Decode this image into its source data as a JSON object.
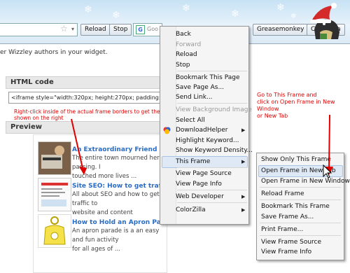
{
  "toolbar": {
    "reload_label": "Reload",
    "stop_label": "Stop",
    "search_placeholder": "Goo",
    "greasemonkey_label": "Greasemonkey",
    "colorzilla_label": "ColorZilla"
  },
  "page": {
    "top_text": "er Wizzley authors in your widget.",
    "html_code_heading": "HTML code",
    "code_value": "<iframe style=\"width:320px; height:270px; padding:2px; l",
    "preview_heading": "Preview",
    "instruction_left": "Right-click inside of the actual frame borders to get the menu shown on the right",
    "instruction_right_line1": "Go to This Frame and",
    "instruction_right_line2": "click on Open Frame in New Window",
    "instruction_right_line3": "or New Tab",
    "posts": [
      {
        "title": "An Extraordinary Friend",
        "desc1": "The entire town mourned her passing. I",
        "desc2": "touched more lives ..."
      },
      {
        "title": "Site SEO: How to get traffic",
        "desc1": "All about SEO and how to get traffic to",
        "desc2": "website and content"
      },
      {
        "title": "How to Hold an Apron Parade",
        "desc1": "An apron parade is a an easy and fun activity",
        "desc2": "for all ages of ..."
      }
    ]
  },
  "context_menu": {
    "back": "Back",
    "forward": "Forward",
    "reload": "Reload",
    "stop": "Stop",
    "bookmark": "Bookmark This Page",
    "save_page": "Save Page As...",
    "send_link": "Send Link...",
    "view_bg": "View Background Image",
    "select_all": "Select All",
    "downloadhelper": "DownloadHelper",
    "highlight": "Highlight Keyword...",
    "keyword_density": "Show Keyword Density...",
    "this_frame": "This Frame",
    "view_source": "View Page Source",
    "view_info": "View Page Info",
    "web_developer": "Web Developer",
    "colorzilla": "ColorZilla"
  },
  "frame_submenu": {
    "show_only": "Show Only This Frame",
    "new_tab": "Open Frame in New Tab",
    "new_window": "Open Frame in New Window",
    "reload_frame": "Reload Frame",
    "bookmark_frame": "Bookmark This Frame",
    "save_frame": "Save Frame As...",
    "print_frame": "Print Frame...",
    "view_frame_source": "View Frame Source",
    "view_frame_info": "View Frame Info"
  },
  "colors": {
    "annotation_red": "#e00000",
    "link_blue": "#2a6cc4",
    "menu_highlight": "#dfe9f5"
  }
}
